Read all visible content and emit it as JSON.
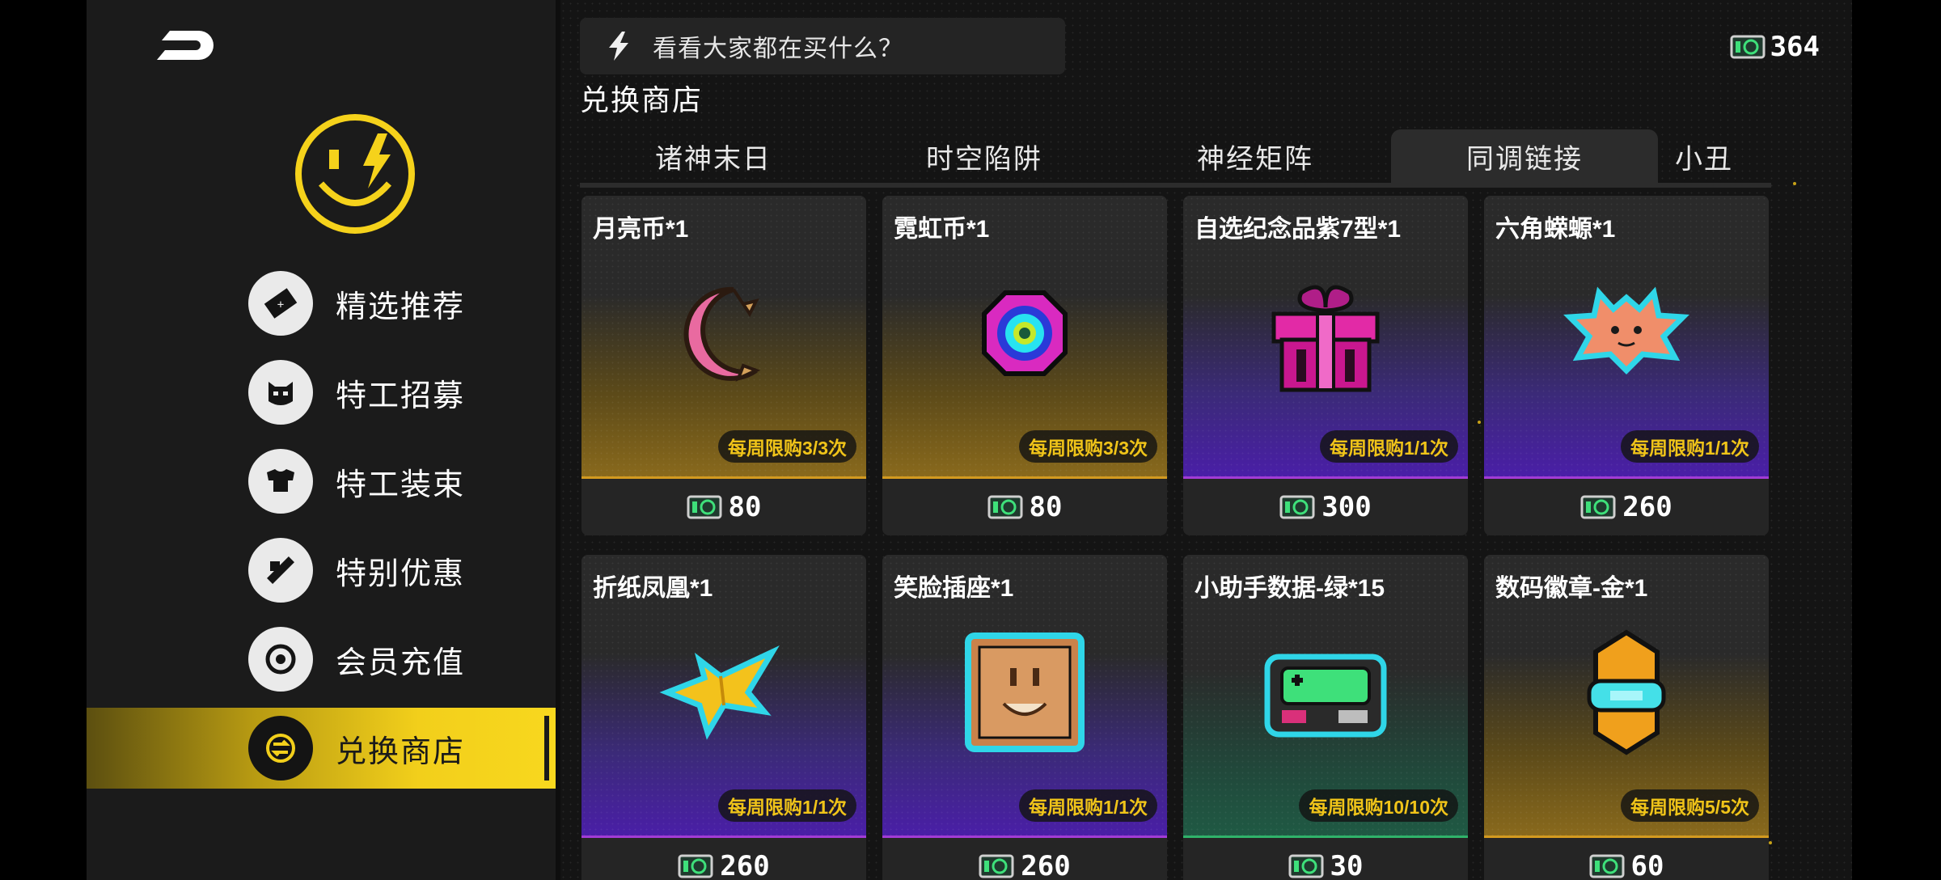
{
  "header": {
    "ticker_text": "看看大家都在买什么？",
    "currency_amount": "364",
    "section_title": "兑换商店"
  },
  "sidebar": {
    "items": [
      {
        "label": "精选推荐",
        "icon": "ticket-icon"
      },
      {
        "label": "特工招募",
        "icon": "agent-face-icon"
      },
      {
        "label": "特工装束",
        "icon": "outfit-icon"
      },
      {
        "label": "特别优惠",
        "icon": "wrench-icon"
      },
      {
        "label": "会员充值",
        "icon": "coin-ring-icon"
      },
      {
        "label": "兑换商店",
        "icon": "exchange-icon",
        "active": true
      }
    ]
  },
  "tabs": [
    {
      "label": "诸神末日"
    },
    {
      "label": "时空陷阱"
    },
    {
      "label": "神经矩阵"
    },
    {
      "label": "同调链接",
      "active": true
    },
    {
      "label": "小丑"
    }
  ],
  "cards": [
    {
      "name": "月亮币*1",
      "limit": "每周限购3/3次",
      "price": "80",
      "theme": "gold",
      "art": "crescent-moon"
    },
    {
      "name": "霓虹币*1",
      "limit": "每周限购3/3次",
      "price": "80",
      "theme": "gold",
      "art": "neon-coin"
    },
    {
      "name": "自选纪念品紫7型*1",
      "limit": "每周限购1/1次",
      "price": "300",
      "theme": "purple",
      "art": "gift-box"
    },
    {
      "name": "六角蝾螈*1",
      "limit": "每周限购1/1次",
      "price": "260",
      "theme": "purple",
      "art": "axolotl"
    },
    {
      "name": "折纸凤凰*1",
      "limit": "每周限购1/1次",
      "price": "260",
      "theme": "purple",
      "art": "paper-phoenix"
    },
    {
      "name": "笑脸插座*1",
      "limit": "每周限购1/1次",
      "price": "260",
      "theme": "purple",
      "art": "smiley-socket"
    },
    {
      "name": "小助手数据-绿*15",
      "limit": "每周限购10/10次",
      "price": "30",
      "theme": "green",
      "art": "data-chip"
    },
    {
      "name": "数码徽章-金*1",
      "limit": "每周限购5/5次",
      "price": "60",
      "theme": "gold",
      "art": "gold-badge"
    }
  ],
  "colors": {
    "accent_yellow": "#f2cf1b",
    "limit_text": "#f0c419",
    "gold_line": "#d39a1f",
    "purple_line": "#a23bd6",
    "green_line": "#2fb36a"
  }
}
